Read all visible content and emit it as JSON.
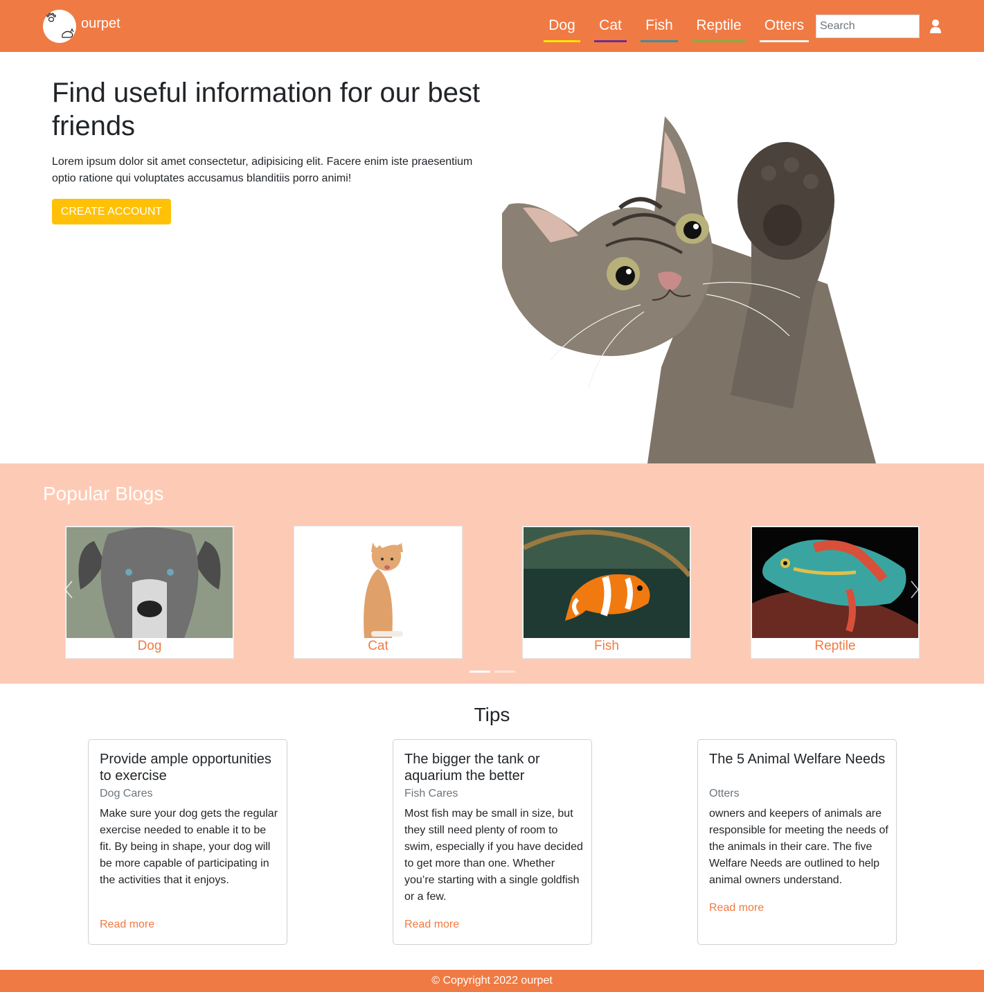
{
  "header": {
    "brand": "ourpet",
    "nav": [
      {
        "label": "Dog",
        "color": "#ffe600"
      },
      {
        "label": "Cat",
        "color": "#6f2c91"
      },
      {
        "label": "Fish",
        "color": "#3c8fa0"
      },
      {
        "label": "Reptile",
        "color": "#7cb342"
      },
      {
        "label": "Otters",
        "color": "#f2f2f2"
      }
    ],
    "search_placeholder": "Search",
    "icons": {
      "logo": "paw-cat-logo",
      "user": "user-icon"
    }
  },
  "hero": {
    "title": "Find useful information for our best friends",
    "text": "Lorem ipsum dolor sit amet consectetur, adipisicing elit. Facere enim iste praesentium optio ratione qui voluptates accusamus blanditiis porro animi!",
    "button": "CREATE ACCOUNT"
  },
  "blogs": {
    "title": "Popular Blogs",
    "items": [
      {
        "label": "Dog"
      },
      {
        "label": "Cat"
      },
      {
        "label": "Fish"
      },
      {
        "label": "Reptile"
      }
    ],
    "active_indicator": 1,
    "indicator_count": 2
  },
  "tips": {
    "title": "Tips",
    "cards": [
      {
        "title": "Provide ample opportunities to exercise",
        "subtitle": "Dog Cares",
        "text": "Make sure your dog gets the regular exercise needed to enable it to be fit. By being in shape, your dog will be more capable of participating in the activities that it enjoys.",
        "link": "Read more"
      },
      {
        "title": "The bigger the tank or aquarium the better",
        "subtitle": "Fish Cares",
        "text": "Most fish may be small in size, but they still need plenty of room to swim, especially if you have decided to get more than one. Whether you’re starting with a single goldfish or a few.",
        "link": "Read more"
      },
      {
        "title": "The 5 Animal Welfare Needs",
        "subtitle": "Otters",
        "text": "owners and keepers of animals are responsible for meeting the needs of the animals in their care. The five Welfare Needs are outlined to help animal owners understand.",
        "link": "Read more"
      }
    ]
  },
  "colors": {
    "primary": "#f07a43",
    "blogs_bg": "#fdcbb5",
    "button": "#ffc107"
  },
  "footer": {
    "text": "© Copyright 2022 ourpet"
  }
}
